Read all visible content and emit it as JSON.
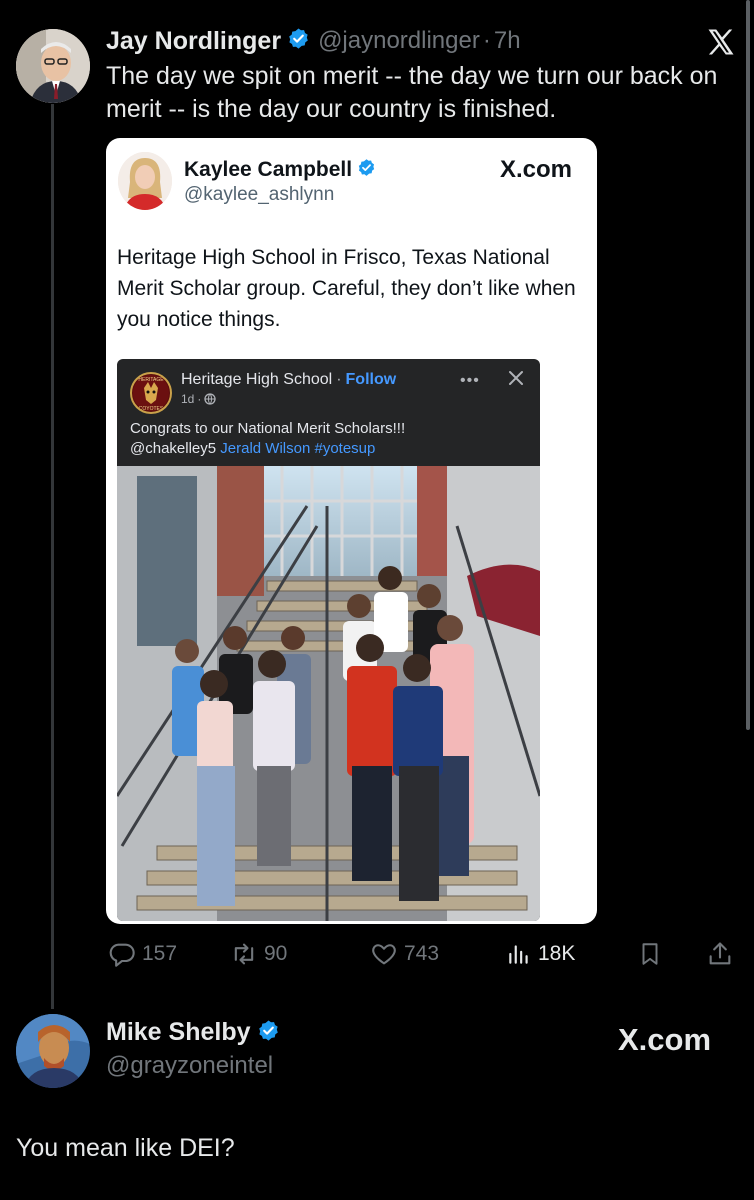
{
  "tweet": {
    "author_name": "Jay Nordlinger",
    "handle": "@jaynordlinger",
    "separator": "·",
    "time": "7h",
    "text": "The day we spit on merit -- the day we turn our back on merit -- is the day our country is finished.",
    "brand_icon": "x-logo-icon"
  },
  "quote": {
    "author_name": "Kaylee Campbell",
    "handle": "@kaylee_ashlynn",
    "brand": "X.com",
    "text": "Heritage High School in Frisco, Texas National Merit Scholar group. Careful, they don’t like when you notice things.",
    "fb_post": {
      "page_name": "Heritage High School",
      "separator": "·",
      "follow": "Follow",
      "age": "1d",
      "dot": "·",
      "badge_text_top": "HERITAGE",
      "badge_text_bottom": "COYOTES",
      "line1": "Congrats to our National Merit Scholars!!!",
      "mention": "@chakelley5",
      "tag_name": "Jerald Wilson",
      "hashtag": "#yotesup"
    }
  },
  "actions": {
    "replies": "157",
    "reposts": "90",
    "likes": "743",
    "views": "18K"
  },
  "reply": {
    "author_name": "Mike Shelby",
    "handle": "@grayzoneintel",
    "brand": "X.com",
    "text": "You mean like DEI?"
  },
  "colors": {
    "background": "#000000",
    "verified_blue": "#1d9bf0",
    "muted": "#71767b",
    "fb_link": "#4599ff"
  }
}
